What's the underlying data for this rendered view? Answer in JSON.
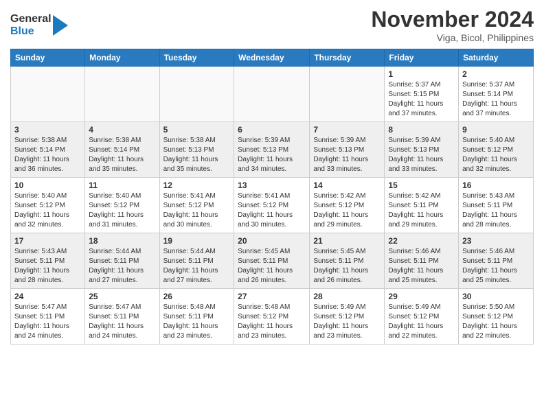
{
  "header": {
    "logo_general": "General",
    "logo_blue": "Blue",
    "month_title": "November 2024",
    "location": "Viga, Bicol, Philippines"
  },
  "days_of_week": [
    "Sunday",
    "Monday",
    "Tuesday",
    "Wednesday",
    "Thursday",
    "Friday",
    "Saturday"
  ],
  "weeks": [
    [
      {
        "num": "",
        "info": ""
      },
      {
        "num": "",
        "info": ""
      },
      {
        "num": "",
        "info": ""
      },
      {
        "num": "",
        "info": ""
      },
      {
        "num": "",
        "info": ""
      },
      {
        "num": "1",
        "info": "Sunrise: 5:37 AM\nSunset: 5:15 PM\nDaylight: 11 hours and 37 minutes."
      },
      {
        "num": "2",
        "info": "Sunrise: 5:37 AM\nSunset: 5:14 PM\nDaylight: 11 hours and 37 minutes."
      }
    ],
    [
      {
        "num": "3",
        "info": "Sunrise: 5:38 AM\nSunset: 5:14 PM\nDaylight: 11 hours and 36 minutes."
      },
      {
        "num": "4",
        "info": "Sunrise: 5:38 AM\nSunset: 5:14 PM\nDaylight: 11 hours and 35 minutes."
      },
      {
        "num": "5",
        "info": "Sunrise: 5:38 AM\nSunset: 5:13 PM\nDaylight: 11 hours and 35 minutes."
      },
      {
        "num": "6",
        "info": "Sunrise: 5:39 AM\nSunset: 5:13 PM\nDaylight: 11 hours and 34 minutes."
      },
      {
        "num": "7",
        "info": "Sunrise: 5:39 AM\nSunset: 5:13 PM\nDaylight: 11 hours and 33 minutes."
      },
      {
        "num": "8",
        "info": "Sunrise: 5:39 AM\nSunset: 5:13 PM\nDaylight: 11 hours and 33 minutes."
      },
      {
        "num": "9",
        "info": "Sunrise: 5:40 AM\nSunset: 5:12 PM\nDaylight: 11 hours and 32 minutes."
      }
    ],
    [
      {
        "num": "10",
        "info": "Sunrise: 5:40 AM\nSunset: 5:12 PM\nDaylight: 11 hours and 32 minutes."
      },
      {
        "num": "11",
        "info": "Sunrise: 5:40 AM\nSunset: 5:12 PM\nDaylight: 11 hours and 31 minutes."
      },
      {
        "num": "12",
        "info": "Sunrise: 5:41 AM\nSunset: 5:12 PM\nDaylight: 11 hours and 30 minutes."
      },
      {
        "num": "13",
        "info": "Sunrise: 5:41 AM\nSunset: 5:12 PM\nDaylight: 11 hours and 30 minutes."
      },
      {
        "num": "14",
        "info": "Sunrise: 5:42 AM\nSunset: 5:12 PM\nDaylight: 11 hours and 29 minutes."
      },
      {
        "num": "15",
        "info": "Sunrise: 5:42 AM\nSunset: 5:11 PM\nDaylight: 11 hours and 29 minutes."
      },
      {
        "num": "16",
        "info": "Sunrise: 5:43 AM\nSunset: 5:11 PM\nDaylight: 11 hours and 28 minutes."
      }
    ],
    [
      {
        "num": "17",
        "info": "Sunrise: 5:43 AM\nSunset: 5:11 PM\nDaylight: 11 hours and 28 minutes."
      },
      {
        "num": "18",
        "info": "Sunrise: 5:44 AM\nSunset: 5:11 PM\nDaylight: 11 hours and 27 minutes."
      },
      {
        "num": "19",
        "info": "Sunrise: 5:44 AM\nSunset: 5:11 PM\nDaylight: 11 hours and 27 minutes."
      },
      {
        "num": "20",
        "info": "Sunrise: 5:45 AM\nSunset: 5:11 PM\nDaylight: 11 hours and 26 minutes."
      },
      {
        "num": "21",
        "info": "Sunrise: 5:45 AM\nSunset: 5:11 PM\nDaylight: 11 hours and 26 minutes."
      },
      {
        "num": "22",
        "info": "Sunrise: 5:46 AM\nSunset: 5:11 PM\nDaylight: 11 hours and 25 minutes."
      },
      {
        "num": "23",
        "info": "Sunrise: 5:46 AM\nSunset: 5:11 PM\nDaylight: 11 hours and 25 minutes."
      }
    ],
    [
      {
        "num": "24",
        "info": "Sunrise: 5:47 AM\nSunset: 5:11 PM\nDaylight: 11 hours and 24 minutes."
      },
      {
        "num": "25",
        "info": "Sunrise: 5:47 AM\nSunset: 5:11 PM\nDaylight: 11 hours and 24 minutes."
      },
      {
        "num": "26",
        "info": "Sunrise: 5:48 AM\nSunset: 5:11 PM\nDaylight: 11 hours and 23 minutes."
      },
      {
        "num": "27",
        "info": "Sunrise: 5:48 AM\nSunset: 5:12 PM\nDaylight: 11 hours and 23 minutes."
      },
      {
        "num": "28",
        "info": "Sunrise: 5:49 AM\nSunset: 5:12 PM\nDaylight: 11 hours and 23 minutes."
      },
      {
        "num": "29",
        "info": "Sunrise: 5:49 AM\nSunset: 5:12 PM\nDaylight: 11 hours and 22 minutes."
      },
      {
        "num": "30",
        "info": "Sunrise: 5:50 AM\nSunset: 5:12 PM\nDaylight: 11 hours and 22 minutes."
      }
    ]
  ]
}
